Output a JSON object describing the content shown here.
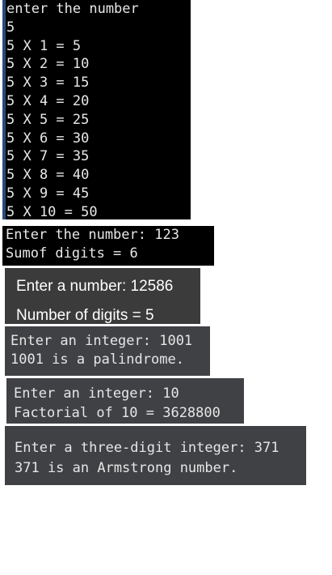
{
  "panels": {
    "multiplication_table": {
      "lines": [
        "enter the number",
        "5",
        "5 X 1 = 5",
        "5 X 2 = 10",
        "5 X 3 = 15",
        "5 X 4 = 20",
        "5 X 5 = 25",
        "5 X 6 = 30",
        "5 X 7 = 35",
        "5 X 8 = 40",
        "5 X 9 = 45",
        "5 X 10 = 50"
      ]
    },
    "sum_of_digits": {
      "lines": [
        "Enter the number: 123",
        "Sumof digits = 6"
      ]
    },
    "number_of_digits": {
      "lines": [
        "Enter a number: 12586",
        "Number of digits = 5"
      ]
    },
    "palindrome": {
      "lines": [
        "Enter an integer: 1001",
        "1001 is a palindrome."
      ]
    },
    "factorial": {
      "lines": [
        "Enter an integer: 10",
        "Factorial of 10 = 3628800"
      ]
    },
    "armstrong": {
      "lines": [
        "Enter a three-digit integer: 371",
        "371 is an Armstrong number."
      ]
    }
  },
  "colors": {
    "terminal_black": "#000000",
    "terminal_gray": "#3f4145",
    "accent_border": "#2a4a7a"
  }
}
